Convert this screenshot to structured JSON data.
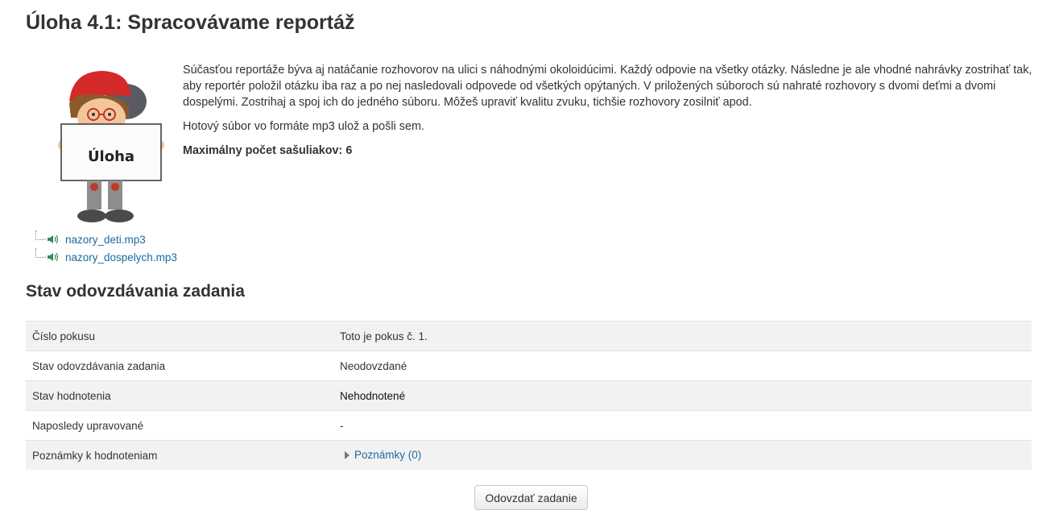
{
  "page": {
    "title": "Úloha 4.1: Spracovávame reportáž"
  },
  "intro": {
    "paragraph1": "Súčasťou reportáže býva aj natáčanie rozhovorov na ulici s náhodnými okoloidúcimi. Každý odpovie na všetky otázky. Následne je ale vhodné nahrávky zostrihať tak, aby reportér položil otázku iba raz a po nej nasledovali odpovede od všetkých opýtaných. V priložených súboroch sú nahraté rozhovory s dvomi deťmi a dvomi dospelými. Zostrihaj a spoj ich do jedného súboru. Môžeš upraviť kvalitu zvuku, tichšie rozhovory zosilniť apod.",
    "paragraph2": "Hotový súbor vo formáte mp3 ulož a pošli sem.",
    "paragraph3": "Maximálny počet sašuliakov: 6",
    "illustration_sign": "Úloha"
  },
  "files": [
    {
      "name": "nazory_deti.mp3",
      "icon": "audio-file-icon"
    },
    {
      "name": "nazory_dospelych.mp3",
      "icon": "audio-file-icon"
    }
  ],
  "status_section": {
    "title": "Stav odovzdávania zadania",
    "rows": [
      {
        "label": "Číslo pokusu",
        "value": "Toto je pokus č. 1."
      },
      {
        "label": "Stav odovzdávania zadania",
        "value": "Neodovzdané"
      },
      {
        "label": "Stav hodnotenia",
        "value": "Nehodnotené"
      },
      {
        "label": "Naposledy upravované",
        "value": "-"
      },
      {
        "label": "Poznámky k hodnoteniam",
        "value": "Poznámky (0)"
      }
    ]
  },
  "actions": {
    "submit_label": "Odovzdať zadanie"
  },
  "colors": {
    "link": "#1b6aa0",
    "row_stripe": "#f2f2f2"
  }
}
